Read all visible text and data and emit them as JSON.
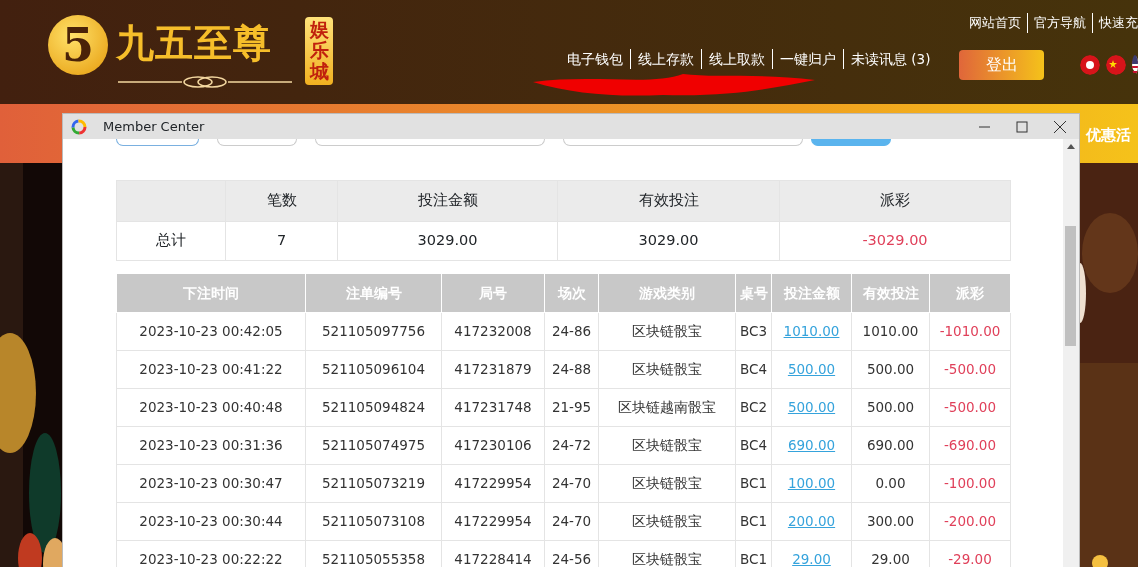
{
  "site": {
    "logo_mark": "5",
    "logo_text": "九五至尊",
    "logo_badge": "娱乐城"
  },
  "top_links": [
    "网站首页",
    "官方导航",
    "快速充"
  ],
  "nav": [
    "电子钱包",
    "线上存款",
    "线上取款",
    "一键归户",
    "未读讯息 (3)"
  ],
  "logout": "登出",
  "promo": "优惠活",
  "window": {
    "title": "Member Center"
  },
  "summary": {
    "columns": [
      "",
      "笔数",
      "投注金额",
      "有效投注",
      "派彩"
    ],
    "row": {
      "label": "总计",
      "count": "7",
      "bet": "3029.00",
      "valid": "3029.00",
      "payout": "-3029.00",
      "loss": true
    }
  },
  "table": {
    "columns": [
      "下注时间",
      "注单编号",
      "局号",
      "场次",
      "游戏类别",
      "桌号",
      "投注金额",
      "有效投注",
      "派彩"
    ],
    "rows": [
      {
        "time": "2023-10-23 00:42:05",
        "order": "521105097756",
        "round": "417232008",
        "session": "24-86",
        "game": "区块链骰宝",
        "table": "BC3",
        "bet": "1010.00",
        "valid": "1010.00",
        "payout": "-1010.00",
        "loss": true
      },
      {
        "time": "2023-10-23 00:41:22",
        "order": "521105096104",
        "round": "417231879",
        "session": "24-88",
        "game": "区块链骰宝",
        "table": "BC4",
        "bet": "500.00",
        "valid": "500.00",
        "payout": "-500.00",
        "loss": true
      },
      {
        "time": "2023-10-23 00:40:48",
        "order": "521105094824",
        "round": "417231748",
        "session": "21-95",
        "game": "区块链越南骰宝",
        "table": "BC2",
        "bet": "500.00",
        "valid": "500.00",
        "payout": "-500.00",
        "loss": true
      },
      {
        "time": "2023-10-23 00:31:36",
        "order": "521105074975",
        "round": "417230106",
        "session": "24-72",
        "game": "区块链骰宝",
        "table": "BC4",
        "bet": "690.00",
        "valid": "690.00",
        "payout": "-690.00",
        "loss": true
      },
      {
        "time": "2023-10-23 00:30:47",
        "order": "521105073219",
        "round": "417229954",
        "session": "24-70",
        "game": "区块链骰宝",
        "table": "BC1",
        "bet": "100.00",
        "valid": "0.00",
        "payout": "-100.00",
        "loss": true
      },
      {
        "time": "2023-10-23 00:30:44",
        "order": "521105073108",
        "round": "417229954",
        "session": "24-70",
        "game": "区块链骰宝",
        "table": "BC1",
        "bet": "200.00",
        "valid": "300.00",
        "payout": "-200.00",
        "loss": true
      },
      {
        "time": "2023-10-23 00:22:22",
        "order": "521105055358",
        "round": "417228414",
        "session": "24-56",
        "game": "区块链骰宝",
        "table": "BC1",
        "bet": "29.00",
        "valid": "29.00",
        "payout": "-29.00",
        "loss": true
      }
    ]
  }
}
